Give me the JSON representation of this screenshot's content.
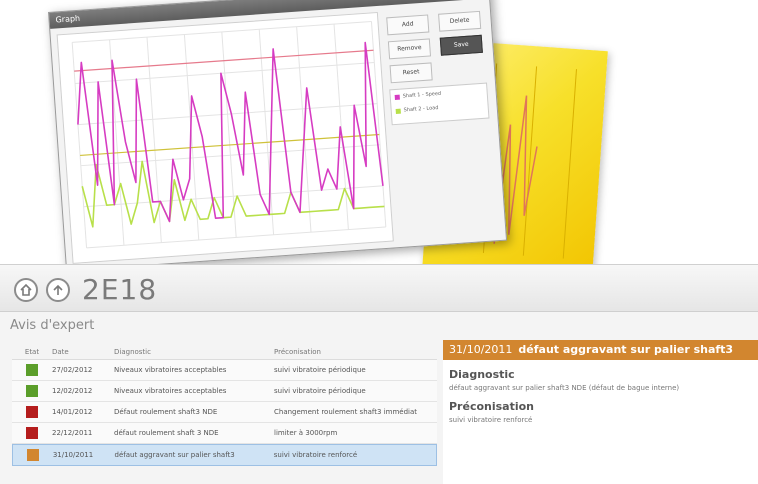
{
  "chart_window": {
    "title": "Graph",
    "close_label": "✕",
    "side_buttons": [
      "Add",
      "Remove",
      "Reset",
      "Delete",
      "Save"
    ],
    "legend": [
      {
        "name": "Shaft 1 - Speed",
        "color": "#d63cc2"
      },
      {
        "name": "Shaft 2 - Load",
        "color": "#b8e04a"
      }
    ]
  },
  "chart_data": {
    "type": "line",
    "title": "",
    "xlabel": "",
    "ylabel": "",
    "ylim": [
      0,
      10
    ],
    "series": [
      {
        "name": "Shaft 1 - Speed",
        "color": "#d63cc2",
        "values": [
          6,
          9,
          3,
          8,
          2,
          9,
          5,
          3,
          8,
          2,
          2,
          1,
          4,
          2,
          3,
          7,
          5,
          1,
          1,
          8,
          6,
          3,
          7,
          2,
          1,
          5,
          9,
          2,
          1,
          4,
          7,
          2,
          3,
          2,
          5,
          1,
          6,
          3,
          9,
          2
        ]
      },
      {
        "name": "Shaft 2 - Load",
        "color": "#b8e04a",
        "values": [
          3,
          1,
          4,
          2,
          2,
          3,
          1,
          2,
          4,
          1,
          2,
          1,
          3,
          1,
          2,
          1,
          1,
          2,
          1,
          1,
          2,
          1,
          1,
          1,
          1,
          1,
          1,
          2,
          1,
          1,
          1,
          1,
          1,
          1,
          2,
          1,
          1,
          1,
          1,
          1
        ]
      }
    ],
    "reference_lines": [
      {
        "value": 8.6,
        "color": "#e67a8c"
      },
      {
        "value": 4.5,
        "color": "#cfc23a"
      }
    ]
  },
  "header": {
    "title": "2E18"
  },
  "section": {
    "label": "Avis d'expert"
  },
  "table": {
    "columns": [
      "Etat",
      "Date",
      "Diagnostic",
      "Préconisation"
    ],
    "rows": [
      {
        "color": "#5b9e2a",
        "date": "27/02/2012",
        "diagnostic": "Niveaux vibratoires acceptables",
        "preconisation": "suivi vibratoire périodique"
      },
      {
        "color": "#5b9e2a",
        "date": "12/02/2012",
        "diagnostic": "Niveaux vibratoires acceptables",
        "preconisation": "suivi vibratoire périodique"
      },
      {
        "color": "#b51d1d",
        "date": "14/01/2012",
        "diagnostic": "Défaut roulement shaft3 NDE",
        "preconisation": "Changement roulement shaft3 immédiat"
      },
      {
        "color": "#b51d1d",
        "date": "22/12/2011",
        "diagnostic": "défaut roulement shaft 3 NDE",
        "preconisation": "limiter à 3000rpm"
      },
      {
        "color": "#d2862f",
        "date": "31/10/2011",
        "diagnostic": "défaut aggravant sur palier shaft3",
        "preconisation": "suivi vibratoire renforcé"
      }
    ]
  },
  "detail": {
    "date": "31/10/2011",
    "title": "défaut aggravant sur palier shaft3",
    "diagnostic_label": "Diagnostic",
    "diagnostic_text": "défaut aggravant sur palier shaft3 NDE (défaut de bague interne)",
    "preconisation_label": "Préconisation",
    "preconisation_text": "suivi vibratoire renforcé"
  }
}
